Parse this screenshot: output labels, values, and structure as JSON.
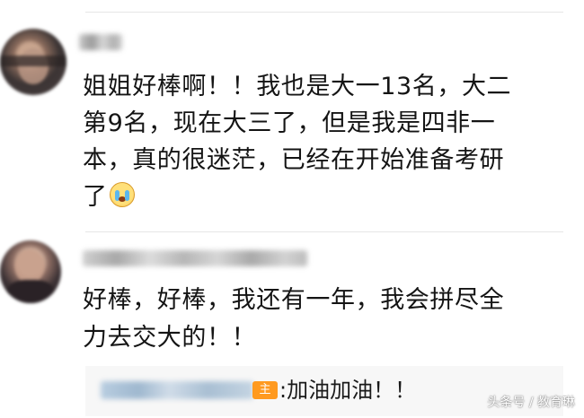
{
  "comments": [
    {
      "lines": [
        "姐姐好棒啊！！我也是大一13名，大二",
        "第9名，现在大三了，但是我是四非一",
        "本，真的很迷茫，已经在开始准备考研",
        "了"
      ],
      "emoji": "crying-face-icon"
    },
    {
      "lines": [
        "好棒，好棒，我还有一年，我会拼尽全",
        "力去交大的！！"
      ],
      "reply": {
        "badge": "主",
        "text": ":加油加油！！"
      }
    }
  ],
  "watermark": "头条号 / 教育琳",
  "colors": {
    "badge": "#ff9a1f",
    "reply_bg": "#f7f7f7",
    "divider": "#e6e6e6"
  }
}
